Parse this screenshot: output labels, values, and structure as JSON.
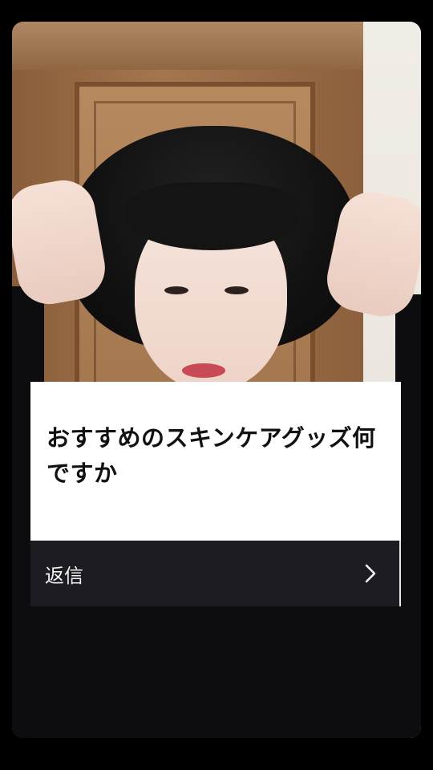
{
  "question_sticker": {
    "question": "おすすめのスキンケアグッズ何ですか",
    "reply_label": "返信",
    "reply_icon": "chevron-right-icon"
  },
  "colors": {
    "sticker_background": "#ffffff",
    "reply_bar_background": "#1c1c22",
    "reply_text": "#f2f2f2",
    "question_text": "#111111"
  }
}
